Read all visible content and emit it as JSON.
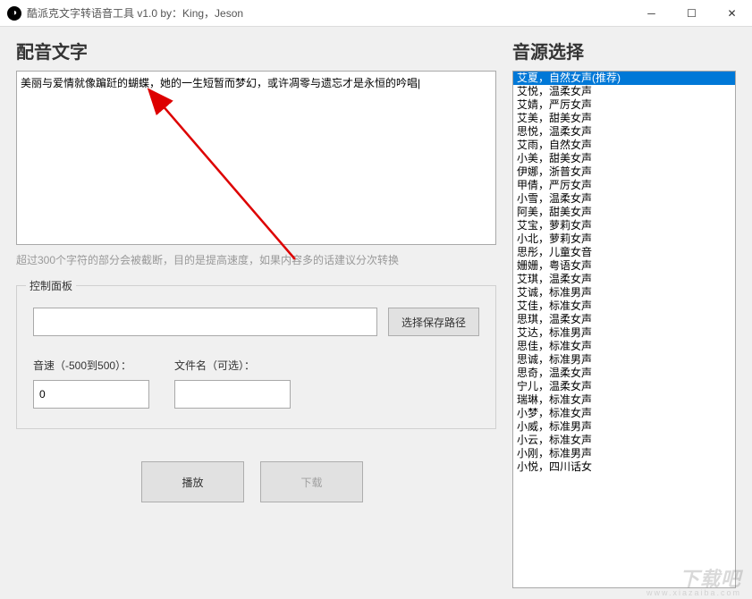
{
  "window": {
    "title": "酷派克文字转语音工具 v1.0 by：King，Jeson"
  },
  "left": {
    "section_title": "配音文字",
    "text_content": "美丽与爱情就像蹁跹的蝴蝶，她的一生短暂而梦幻，或许凋零与遗忘才是永恒的吟唱|",
    "hint": "超过300个字符的部分会被截断，目的是提高速度，如果内容多的话建议分次转换",
    "control_panel_title": "控制面板",
    "path_value": "",
    "path_button": "选择保存路径",
    "speed_label": "音速（-500到500）：",
    "speed_value": "0",
    "filename_label": "文件名（可选）：",
    "filename_value": "",
    "play_button": "播放",
    "download_button": "下载"
  },
  "right": {
    "section_title": "音源选择",
    "voices": [
      {
        "label": "艾夏，自然女声(推荐)",
        "selected": true
      },
      {
        "label": "艾悦，温柔女声"
      },
      {
        "label": "艾婧，严厉女声"
      },
      {
        "label": "艾美，甜美女声"
      },
      {
        "label": "思悦，温柔女声"
      },
      {
        "label": "艾雨，自然女声"
      },
      {
        "label": "小美，甜美女声"
      },
      {
        "label": "伊娜，浙普女声"
      },
      {
        "label": "甲倩，严厉女声"
      },
      {
        "label": "小雪，温柔女声"
      },
      {
        "label": "阿美，甜美女声"
      },
      {
        "label": "艾宝，萝莉女声"
      },
      {
        "label": "小北，萝莉女声"
      },
      {
        "label": "思彤，儿童女音"
      },
      {
        "label": "姗姗，粤语女声"
      },
      {
        "label": "艾琪，温柔女声"
      },
      {
        "label": "艾诚，标准男声"
      },
      {
        "label": "艾佳，标准女声"
      },
      {
        "label": "思琪，温柔女声"
      },
      {
        "label": "艾达，标准男声"
      },
      {
        "label": "思佳，标准女声"
      },
      {
        "label": "思诚，标准男声"
      },
      {
        "label": "思奇，温柔女声"
      },
      {
        "label": "宁儿，温柔女声"
      },
      {
        "label": "瑞琳，标准女声"
      },
      {
        "label": "小梦，标准女声"
      },
      {
        "label": "小威，标准男声"
      },
      {
        "label": "小云，标准女声"
      },
      {
        "label": "小刚，标准男声"
      },
      {
        "label": "小悦，四川话女"
      }
    ]
  },
  "watermark": {
    "main": "下载吧",
    "sub": "www.xiazaiba.com"
  }
}
